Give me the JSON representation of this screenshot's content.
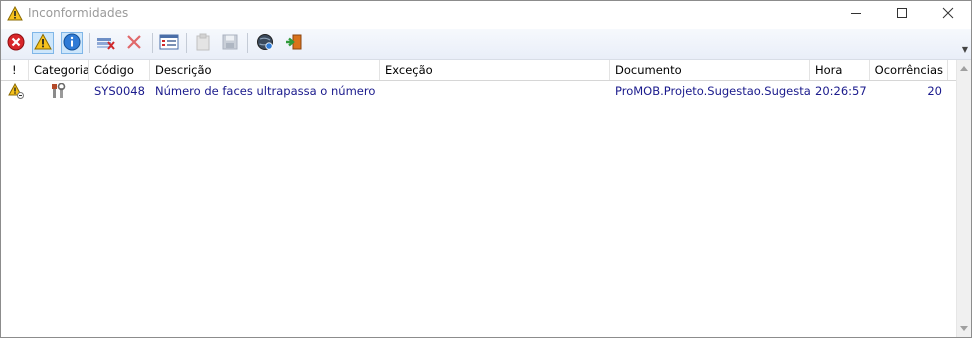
{
  "window": {
    "title": "Inconformidades",
    "title_icon": "warning-icon",
    "controls": [
      "minimize-icon",
      "maximize-icon",
      "close-icon"
    ]
  },
  "toolbar": {
    "buttons": [
      {
        "name": "errors-filter",
        "icon": "error-icon",
        "state": "normal"
      },
      {
        "name": "warnings-filter",
        "icon": "warning-icon",
        "state": "pressed"
      },
      {
        "name": "info-filter",
        "icon": "info-icon",
        "state": "pressed"
      },
      {
        "name": "clear-grid",
        "icon": "clear-icon",
        "state": "normal"
      },
      {
        "name": "delete",
        "icon": "delete-icon",
        "state": "normal"
      },
      {
        "name": "details",
        "icon": "details-icon",
        "state": "normal"
      },
      {
        "name": "copy",
        "icon": "clipboard-icon",
        "state": "disabled"
      },
      {
        "name": "save",
        "icon": "save-icon",
        "state": "disabled"
      },
      {
        "name": "web",
        "icon": "globe-icon",
        "state": "normal"
      },
      {
        "name": "export",
        "icon": "export-icon",
        "state": "normal"
      }
    ],
    "overflow_icon": "chevron-down-icon"
  },
  "grid": {
    "columns": [
      {
        "label": "!"
      },
      {
        "label": "Categoria"
      },
      {
        "label": "Código"
      },
      {
        "label": "Descrição"
      },
      {
        "label": "Exceção"
      },
      {
        "label": "Documento"
      },
      {
        "label": "Hora"
      },
      {
        "label": "Ocorrências"
      }
    ],
    "rows": [
      {
        "severity_icon": "warning-icon",
        "category_icon": "tools-icon",
        "codigo": "SYS0048",
        "descricao": "Número de faces ultrapassa o número rec",
        "excecao": "",
        "documento": "ProMOB.Projeto.Sugestao.Sugestao",
        "hora": "20:26:57",
        "ocorrencias": "20"
      }
    ]
  },
  "colors": {
    "row_text": "#1a1a8c",
    "title_text": "#9a9a9a",
    "pressed_bg": "#cde6fb"
  }
}
